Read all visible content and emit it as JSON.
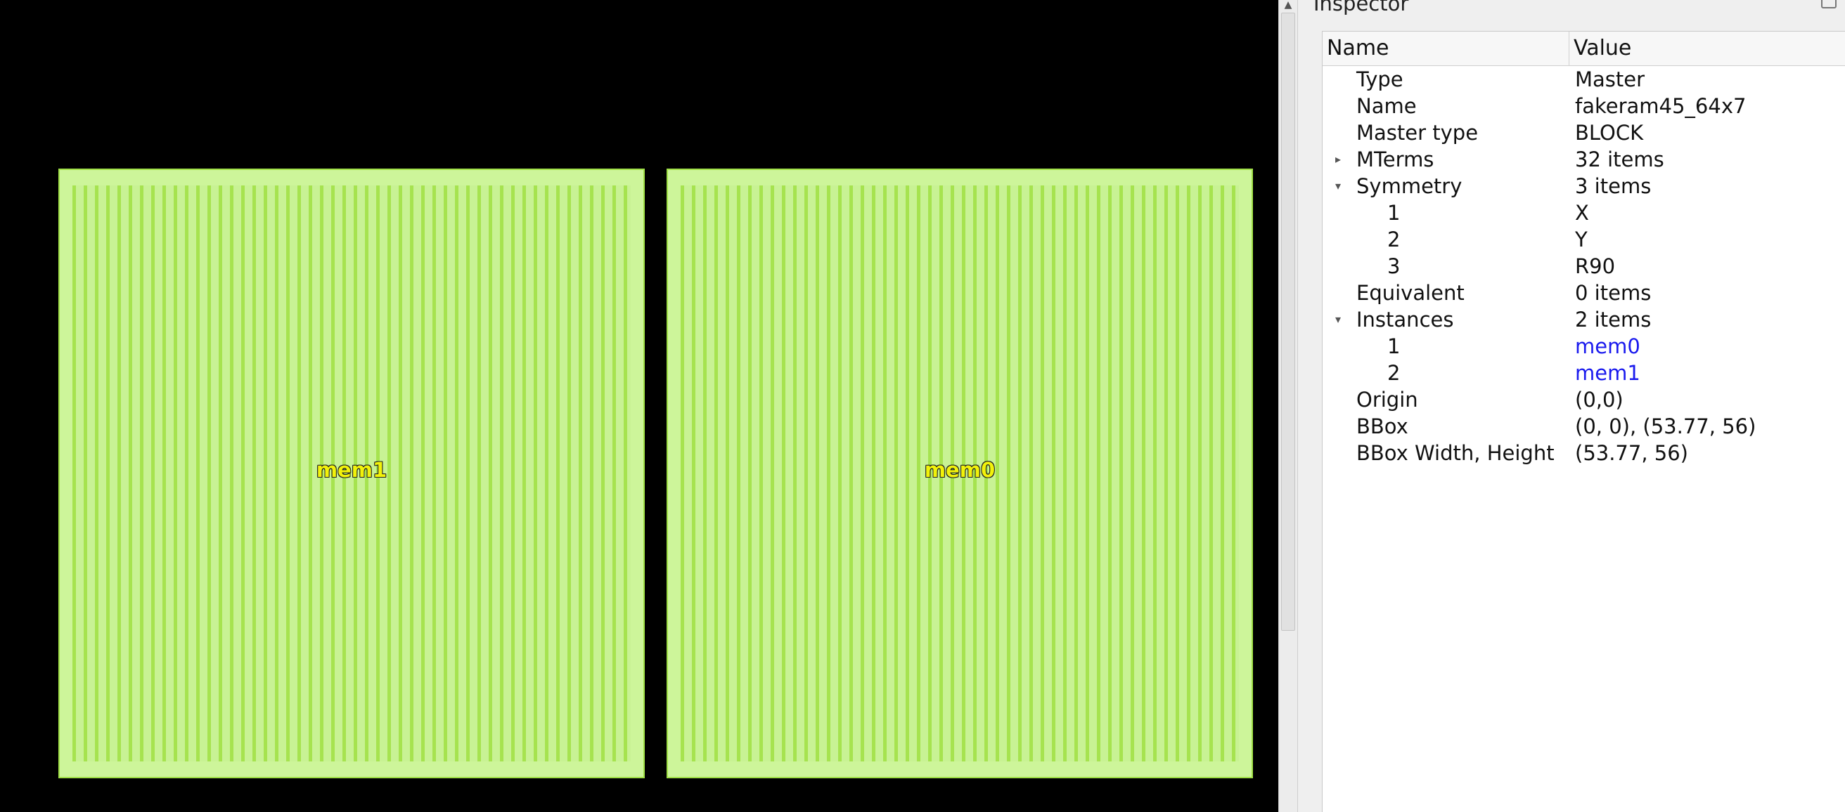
{
  "canvas": {
    "instances": [
      {
        "label": "mem1"
      },
      {
        "label": "mem0"
      }
    ],
    "colors": {
      "fill": "#cdf59a",
      "stripe": "#a6e34f",
      "label": "#f2f20a"
    }
  },
  "inspector": {
    "title": "Inspector",
    "columns": {
      "name": "Name",
      "value": "Value"
    },
    "rows": [
      {
        "name": "Type",
        "value": "Master"
      },
      {
        "name": "Name",
        "value": "fakeram45_64x7"
      },
      {
        "name": "Master type",
        "value": "BLOCK"
      },
      {
        "name": "MTerms",
        "value": "32 items",
        "expander": "collapsed"
      },
      {
        "name": "Symmetry",
        "value": "3 items",
        "expander": "expanded"
      },
      {
        "name": "1",
        "value": "X"
      },
      {
        "name": "2",
        "value": "Y"
      },
      {
        "name": "3",
        "value": "R90"
      },
      {
        "name": "Equivalent",
        "value": "0 items"
      },
      {
        "name": "Instances",
        "value": "2 items",
        "expander": "expanded"
      },
      {
        "name": "1",
        "value": "mem0"
      },
      {
        "name": "2",
        "value": "mem1"
      },
      {
        "name": "Origin",
        "value": "(0,0)"
      },
      {
        "name": "BBox",
        "value": "(0, 0), (53.77, 56)"
      },
      {
        "name": "BBox Width, Height",
        "value": "(53.77, 56)"
      }
    ]
  }
}
